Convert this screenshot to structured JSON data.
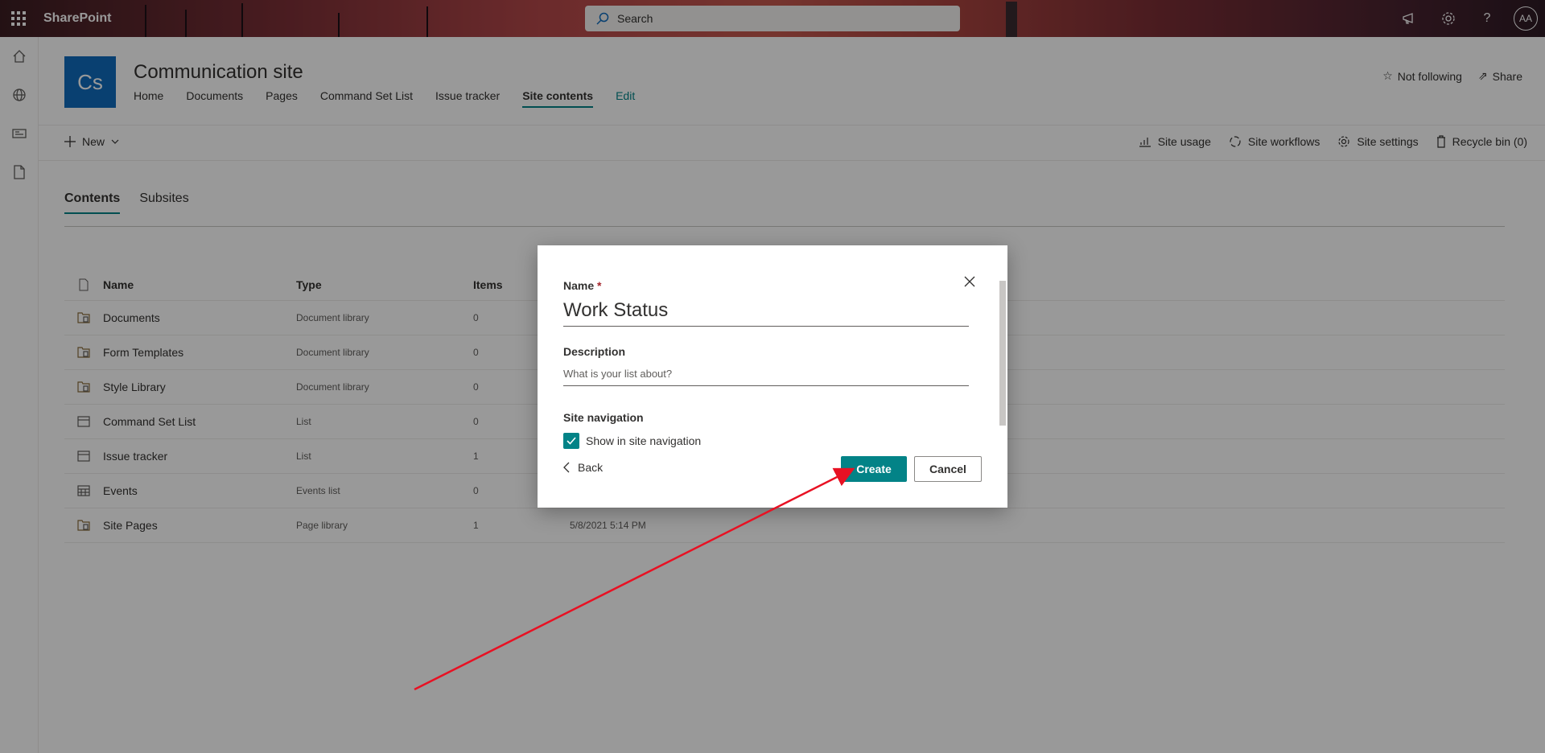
{
  "suite": {
    "brand": "SharePoint",
    "search_placeholder": "Search",
    "avatar": "AA"
  },
  "site": {
    "logo": "Cs",
    "title": "Communication site",
    "nav": [
      "Home",
      "Documents",
      "Pages",
      "Command Set List",
      "Issue tracker",
      "Site contents",
      "Edit"
    ],
    "active_nav": "Site contents",
    "follow": "Not following",
    "share": "Share"
  },
  "commandbar": {
    "new_label": "New",
    "site_usage": "Site usage",
    "site_workflows": "Site workflows",
    "site_settings": "Site settings",
    "recycle_bin": "Recycle bin (0)"
  },
  "tabs": {
    "contents": "Contents",
    "subsites": "Subsites"
  },
  "table": {
    "headers": {
      "name": "Name",
      "type": "Type",
      "items": "Items"
    },
    "rows": [
      {
        "name": "Documents",
        "type": "Document library",
        "items": "0",
        "modified": "",
        "icon": "library-icon"
      },
      {
        "name": "Form Templates",
        "type": "Document library",
        "items": "0",
        "modified": "",
        "icon": "library-icon"
      },
      {
        "name": "Style Library",
        "type": "Document library",
        "items": "0",
        "modified": "",
        "icon": "library-icon"
      },
      {
        "name": "Command Set List",
        "type": "List",
        "items": "0",
        "modified": "",
        "icon": "list-icon"
      },
      {
        "name": "Issue tracker",
        "type": "List",
        "items": "1",
        "modified": "",
        "icon": "list-icon"
      },
      {
        "name": "Events",
        "type": "Events list",
        "items": "0",
        "modified": "",
        "icon": "calendar-icon"
      },
      {
        "name": "Site Pages",
        "type": "Page library",
        "items": "1",
        "modified": "5/8/2021 5:14 PM",
        "icon": "library-icon"
      }
    ]
  },
  "dialog": {
    "name_label": "Name",
    "required_mark": "*",
    "name_value": "Work Status",
    "description_label": "Description",
    "description_placeholder": "What is your list about?",
    "site_nav_label": "Site navigation",
    "show_in_nav_label": "Show in site navigation",
    "show_in_nav_checked": true,
    "back_label": "Back",
    "create_label": "Create",
    "cancel_label": "Cancel"
  },
  "colors": {
    "accent": "#038387",
    "annotation_arrow": "#e81123"
  }
}
